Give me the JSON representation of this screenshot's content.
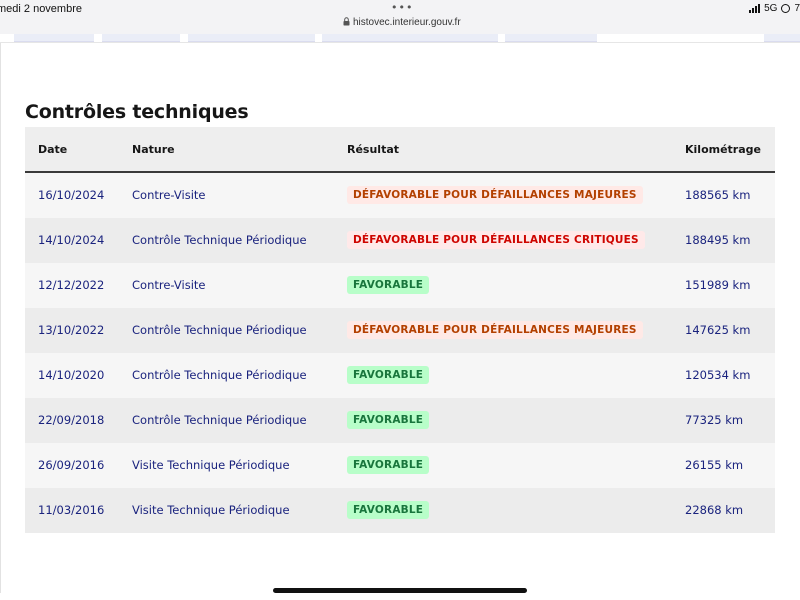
{
  "status_bar": {
    "date": "medi 2 novembre",
    "dots": "•••",
    "url": "histovec.interieur.gouv.fr",
    "network": "5G",
    "battery_partial": "7"
  },
  "section": {
    "title": "Contrôles techniques"
  },
  "table": {
    "headers": {
      "date": "Date",
      "nature": "Nature",
      "result": "Résultat",
      "km": "Kilométrage"
    },
    "rows": [
      {
        "date": "16/10/2024",
        "nature": "Contre-Visite",
        "result": "DÉFAVORABLE POUR DÉFAILLANCES MAJEURES",
        "result_kind": "major",
        "km": "188565 km"
      },
      {
        "date": "14/10/2024",
        "nature": "Contrôle Technique Périodique",
        "result": "DÉFAVORABLE POUR DÉFAILLANCES CRITIQUES",
        "result_kind": "critical",
        "km": "188495 km"
      },
      {
        "date": "12/12/2022",
        "nature": "Contre-Visite",
        "result": "FAVORABLE",
        "result_kind": "ok",
        "km": "151989 km"
      },
      {
        "date": "13/10/2022",
        "nature": "Contrôle Technique Périodique",
        "result": "DÉFAVORABLE POUR DÉFAILLANCES MAJEURES",
        "result_kind": "major",
        "km": "147625 km"
      },
      {
        "date": "14/10/2020",
        "nature": "Contrôle Technique Périodique",
        "result": "FAVORABLE",
        "result_kind": "ok",
        "km": "120534 km"
      },
      {
        "date": "22/09/2018",
        "nature": "Contrôle Technique Périodique",
        "result": "FAVORABLE",
        "result_kind": "ok",
        "km": "77325 km"
      },
      {
        "date": "26/09/2016",
        "nature": "Visite Technique Périodique",
        "result": "FAVORABLE",
        "result_kind": "ok",
        "km": "26155 km"
      },
      {
        "date": "11/03/2016",
        "nature": "Visite Technique Périodique",
        "result": "FAVORABLE",
        "result_kind": "ok",
        "km": "22868 km"
      }
    ]
  },
  "colors": {
    "link_text": "#1a237e",
    "badge_ok_bg": "#b8fec9",
    "badge_ok_fg": "#18753c",
    "badge_major_bg": "#ffe9e6",
    "badge_major_fg": "#b34000",
    "badge_critical_bg": "#ffe9e9",
    "badge_critical_fg": "#ce0500"
  }
}
